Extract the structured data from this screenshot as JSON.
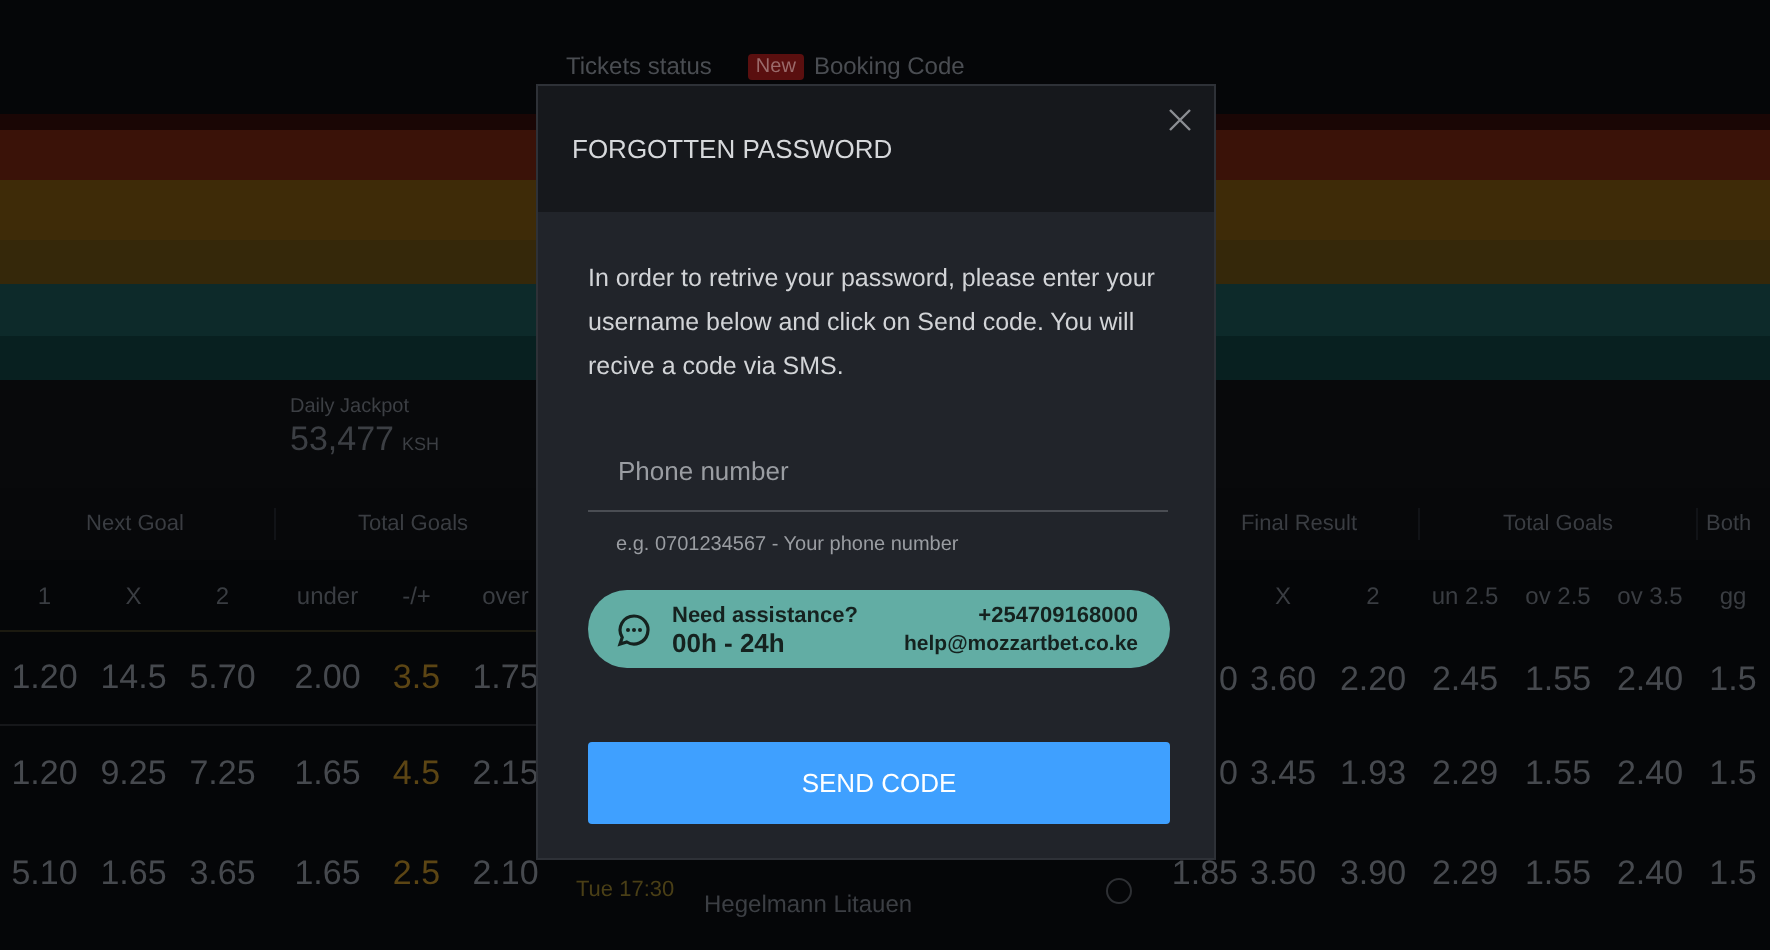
{
  "top_bar": {
    "tabs": [
      {
        "label": "Tickets status"
      },
      {
        "label": "Booking Code",
        "badge": "New"
      }
    ]
  },
  "jackpot": {
    "label": "Daily Jackpot",
    "amount": "53,477",
    "currency": "KSH"
  },
  "left_table": {
    "groups": [
      {
        "title": "Next Goal",
        "columns": [
          {
            "label": "1",
            "kind": "odds"
          },
          {
            "label": "X",
            "kind": "odds"
          },
          {
            "label": "2",
            "kind": "odds"
          }
        ]
      },
      {
        "title": "Total Goals",
        "columns": [
          {
            "label": "under",
            "kind": "odds"
          },
          {
            "label": "-/+",
            "kind": "line"
          },
          {
            "label": "over",
            "kind": "odds"
          }
        ]
      }
    ],
    "rows": [
      [
        "1.20",
        "14.5",
        "5.70",
        "2.00",
        "3.5",
        "1.75"
      ],
      [
        "1.20",
        "9.25",
        "7.25",
        "1.65",
        "4.5",
        "2.15"
      ],
      [
        "5.10",
        "1.65",
        "3.65",
        "1.65",
        "2.5",
        "2.10"
      ]
    ]
  },
  "matches": [
    {
      "time": "Tue 17:30",
      "team": "Hegelmann Litauen"
    }
  ],
  "right_table": {
    "groups": [
      {
        "title": "Final Result",
        "columns": [
          "X",
          "2"
        ]
      },
      {
        "title": "Total Goals",
        "columns": [
          "un 2.5",
          "ov 2.5",
          "ov 3.5"
        ]
      },
      {
        "title": "Both",
        "columns": [
          "gg"
        ]
      }
    ],
    "rows": [
      [
        "0",
        "3.60",
        "2.20",
        "2.45",
        "1.55",
        "2.40",
        "1.5"
      ],
      [
        "0",
        "3.45",
        "1.93",
        "2.29",
        "1.55",
        "2.40",
        "1.5"
      ],
      [
        "1.85",
        "3.50",
        "3.90",
        "2.29",
        "1.55",
        "2.40",
        "1.5"
      ]
    ]
  },
  "modal": {
    "title": "FORGOTTEN PASSWORD",
    "intro": "In order to retrive your password, please enter your username below and click on Send code. You will recive a code via SMS.",
    "phone_field": {
      "placeholder": "Phone number"
    },
    "hint": "e.g. 0701234567 - Your phone number",
    "assistance": {
      "title": "Need assistance?",
      "hours": "00h - 24h",
      "phone": "+254709168000",
      "email": "help@mozzartbet.co.ke"
    },
    "button": "SEND CODE"
  }
}
